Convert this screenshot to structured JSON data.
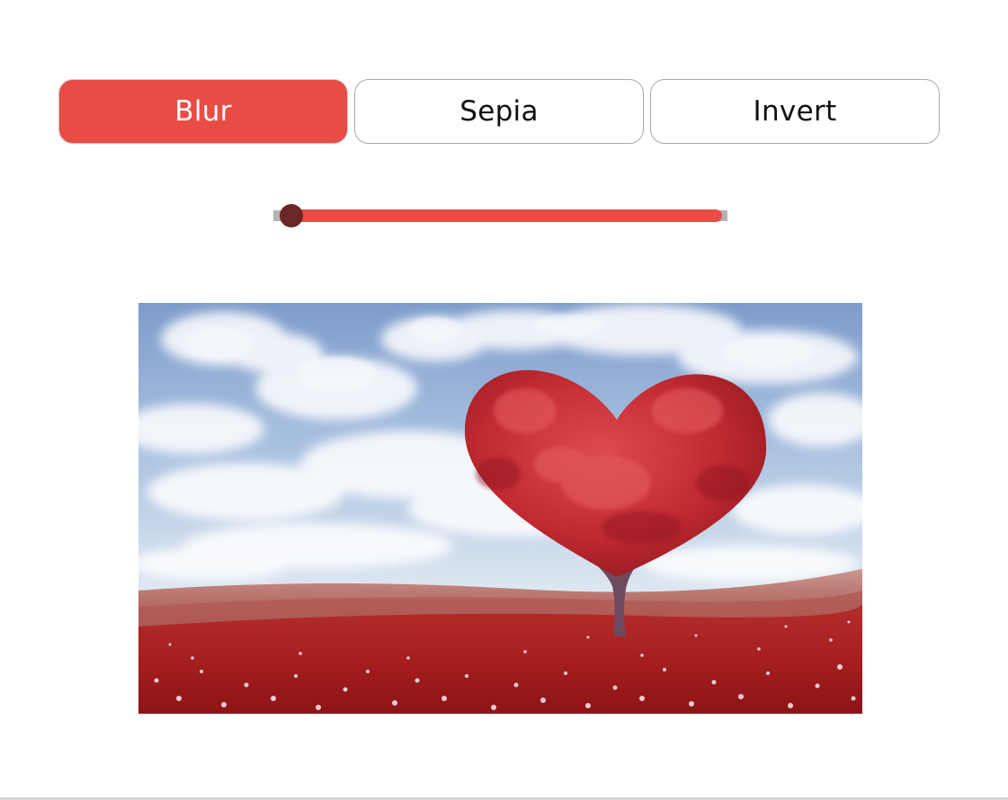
{
  "filters": {
    "buttons": [
      {
        "label": "Blur",
        "active": true
      },
      {
        "label": "Sepia",
        "active": false
      },
      {
        "label": "Invert",
        "active": false
      }
    ]
  },
  "slider": {
    "value_fraction": 0.0
  },
  "image": {
    "subject": "heart-shaped red tree in red flower field under cloudy sky"
  },
  "colors": {
    "accent": "#e84c45",
    "thumb": "#6b2725",
    "rail": "#b3b3b3"
  }
}
